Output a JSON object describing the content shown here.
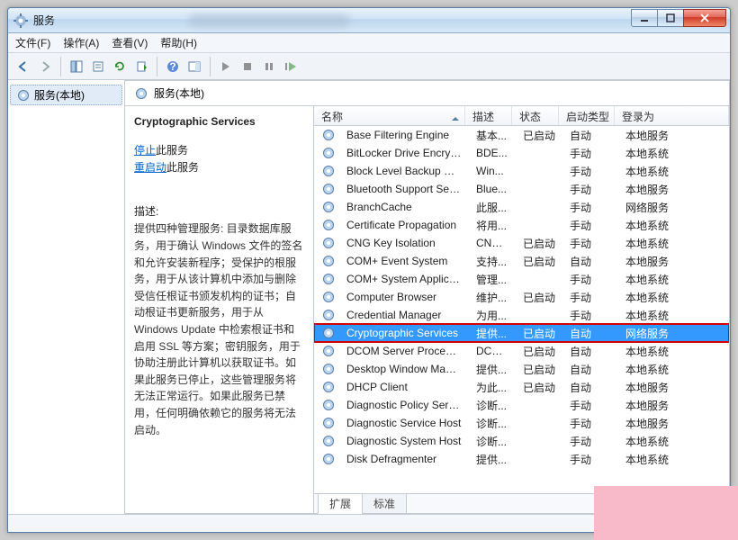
{
  "title": "服务",
  "window_buttons": {
    "min": "min",
    "max": "max",
    "close": "close"
  },
  "menu": [
    "文件(F)",
    "操作(A)",
    "查看(V)",
    "帮助(H)"
  ],
  "sidebar": {
    "item": "服务(本地)"
  },
  "right_header": "服务(本地)",
  "detail": {
    "name": "Cryptographic Services",
    "stop_link": "停止",
    "stop_suffix": "此服务",
    "restart_link": "重启动",
    "restart_suffix": "此服务",
    "desc_label": "描述:",
    "desc": "提供四种管理服务: 目录数据库服务，用于确认 Windows 文件的签名和允许安装新程序；受保护的根服务，用于从该计算机中添加与删除受信任根证书颁发机构的证书；自动根证书更新服务，用于从 Windows Update 中检索根证书和启用 SSL 等方案；密钥服务，用于协助注册此计算机以获取证书。如果此服务已停止，这些管理服务将无法正常运行。如果此服务已禁用，任何明确依赖它的服务将无法启动。"
  },
  "columns": {
    "name": "名称",
    "desc": "描述",
    "stat": "状态",
    "start": "启动类型",
    "log": "登录为"
  },
  "tabs": {
    "ext": "扩展",
    "std": "标准"
  },
  "rows": [
    {
      "name": "Base Filtering Engine",
      "desc": "基本...",
      "stat": "已启动",
      "start": "自动",
      "log": "本地服务",
      "sel": false
    },
    {
      "name": "BitLocker Drive Encryptio...",
      "desc": "BDE...",
      "stat": "",
      "start": "手动",
      "log": "本地系统",
      "sel": false
    },
    {
      "name": "Block Level Backup Engi...",
      "desc": "Win...",
      "stat": "",
      "start": "手动",
      "log": "本地系统",
      "sel": false
    },
    {
      "name": "Bluetooth Support Service",
      "desc": "Blue...",
      "stat": "",
      "start": "手动",
      "log": "本地服务",
      "sel": false
    },
    {
      "name": "BranchCache",
      "desc": "此服...",
      "stat": "",
      "start": "手动",
      "log": "网络服务",
      "sel": false
    },
    {
      "name": "Certificate Propagation",
      "desc": "将用...",
      "stat": "",
      "start": "手动",
      "log": "本地系统",
      "sel": false
    },
    {
      "name": "CNG Key Isolation",
      "desc": "CNG...",
      "stat": "已启动",
      "start": "手动",
      "log": "本地系统",
      "sel": false
    },
    {
      "name": "COM+ Event System",
      "desc": "支持...",
      "stat": "已启动",
      "start": "自动",
      "log": "本地服务",
      "sel": false
    },
    {
      "name": "COM+ System Application",
      "desc": "管理...",
      "stat": "",
      "start": "手动",
      "log": "本地系统",
      "sel": false
    },
    {
      "name": "Computer Browser",
      "desc": "维护...",
      "stat": "已启动",
      "start": "手动",
      "log": "本地系统",
      "sel": false
    },
    {
      "name": "Credential Manager",
      "desc": "为用...",
      "stat": "",
      "start": "手动",
      "log": "本地系统",
      "sel": false
    },
    {
      "name": "Cryptographic Services",
      "desc": "提供...",
      "stat": "已启动",
      "start": "自动",
      "log": "网络服务",
      "sel": true
    },
    {
      "name": "DCOM Server Process La...",
      "desc": "DCO...",
      "stat": "已启动",
      "start": "自动",
      "log": "本地系统",
      "sel": false
    },
    {
      "name": "Desktop Window Manag...",
      "desc": "提供...",
      "stat": "已启动",
      "start": "自动",
      "log": "本地系统",
      "sel": false
    },
    {
      "name": "DHCP Client",
      "desc": "为此...",
      "stat": "已启动",
      "start": "自动",
      "log": "本地服务",
      "sel": false
    },
    {
      "name": "Diagnostic Policy Service",
      "desc": "诊断...",
      "stat": "",
      "start": "手动",
      "log": "本地服务",
      "sel": false
    },
    {
      "name": "Diagnostic Service Host",
      "desc": "诊断...",
      "stat": "",
      "start": "手动",
      "log": "本地服务",
      "sel": false
    },
    {
      "name": "Diagnostic System Host",
      "desc": "诊断...",
      "stat": "",
      "start": "手动",
      "log": "本地系统",
      "sel": false
    },
    {
      "name": "Disk Defragmenter",
      "desc": "提供...",
      "stat": "",
      "start": "手动",
      "log": "本地系统",
      "sel": false
    }
  ]
}
